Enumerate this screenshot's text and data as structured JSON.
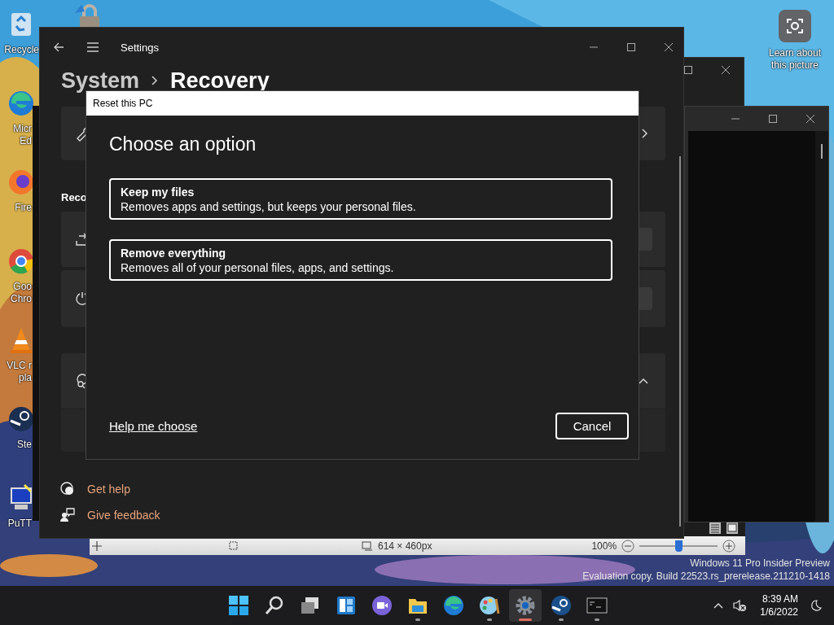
{
  "desktop_icons": [
    {
      "kind": "recycle",
      "label_lines": [
        "Recycle"
      ]
    },
    {
      "kind": "edge",
      "label_lines": [
        "Micr",
        "Ed"
      ]
    },
    {
      "kind": "firefox",
      "label_lines": [
        "Fire"
      ]
    },
    {
      "kind": "chrome",
      "label_lines": [
        "Goo",
        "Chro"
      ]
    },
    {
      "kind": "vlc",
      "label_lines": [
        "VLC r",
        "pla"
      ]
    },
    {
      "kind": "steam",
      "label_lines": [
        "Ste"
      ]
    },
    {
      "kind": "putty",
      "label_lines": [
        "PuTT"
      ]
    }
  ],
  "spotlight": {
    "label_lines": [
      "Learn about",
      "this picture"
    ]
  },
  "paint_status_bar": {
    "dimensions": "614 × 460px",
    "zoom": "100%",
    "zoom_slider": {
      "level": 0.5
    }
  },
  "settings": {
    "title": "Settings",
    "breadcrumb": {
      "parent": "System",
      "current": "Recovery"
    },
    "section_heading": "Reco",
    "cards": [
      {
        "kind": "troubleshoot"
      },
      {
        "kind": "reset"
      },
      {
        "kind": "startup"
      },
      {
        "kind": "help",
        "expanded": true
      },
      {
        "kind": "helpbody"
      }
    ],
    "links": [
      {
        "kind": "help",
        "label": "Get help"
      },
      {
        "kind": "feedback",
        "label": "Give feedback"
      }
    ]
  },
  "dialog": {
    "title": "Reset this PC",
    "heading": "Choose an option",
    "options": [
      {
        "title": "Keep my files",
        "description": "Removes apps and settings, but keeps your personal files."
      },
      {
        "title": "Remove everything",
        "description": "Removes all of your personal files, apps, and settings."
      }
    ],
    "help_link": "Help me choose",
    "cancel": "Cancel"
  },
  "os_notice": [
    "Windows 11 Pro Insider Preview",
    "Evaluation copy. Build 22523.rs_prerelease.211210-1418"
  ],
  "taskbar": {
    "apps": [
      {
        "kind": "start",
        "running": false,
        "active": false
      },
      {
        "kind": "search",
        "running": false,
        "active": false
      },
      {
        "kind": "taskview",
        "running": false,
        "active": false
      },
      {
        "kind": "widgets",
        "running": false,
        "active": false
      },
      {
        "kind": "chat",
        "running": false,
        "active": false
      },
      {
        "kind": "explorer",
        "running": true,
        "active": false
      },
      {
        "kind": "edge",
        "running": false,
        "active": false
      },
      {
        "kind": "paint",
        "running": true,
        "active": false
      },
      {
        "kind": "settings",
        "running": true,
        "active": true
      },
      {
        "kind": "steam",
        "running": true,
        "active": false
      },
      {
        "kind": "terminal",
        "running": true,
        "active": false
      }
    ],
    "clock": {
      "time": "8:39 AM",
      "date": "1/6/2022"
    }
  }
}
